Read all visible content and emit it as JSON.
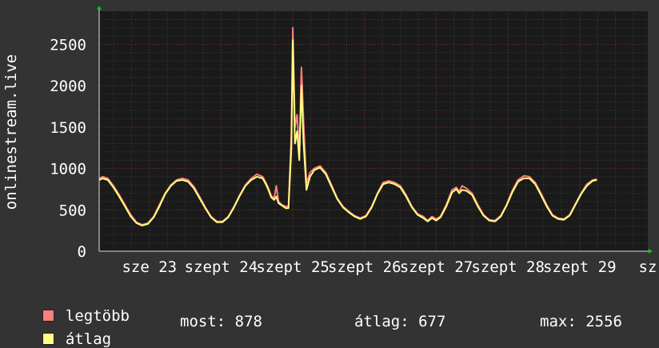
{
  "chart_data": {
    "type": "line",
    "ylabel": "onlinestream.live",
    "ylim": [
      0,
      2900
    ],
    "yticks": [
      0,
      500,
      1000,
      1500,
      2000,
      2500
    ],
    "xlim": [
      22.3,
      29.95
    ],
    "xtick_labels": [
      {
        "x": 23,
        "label": "sze 23"
      },
      {
        "x": 24,
        "label": "szept 24"
      },
      {
        "x": 25,
        "label": "szept 25"
      },
      {
        "x": 26,
        "label": "szept 26"
      },
      {
        "x": 27,
        "label": "szept 27"
      },
      {
        "x": 28,
        "label": "szept 28"
      },
      {
        "x": 29,
        "label": "szept 29"
      },
      {
        "x": 29.95,
        "label": "sz"
      }
    ],
    "grid": true,
    "series": [
      {
        "name": "legtöbb",
        "color": "#ff7f7f",
        "points": [
          [
            22.3,
            880
          ],
          [
            22.35,
            900
          ],
          [
            22.42,
            880
          ],
          [
            22.5,
            790
          ],
          [
            22.58,
            680
          ],
          [
            22.66,
            560
          ],
          [
            22.74,
            440
          ],
          [
            22.82,
            350
          ],
          [
            22.9,
            320
          ],
          [
            22.98,
            340
          ],
          [
            23.06,
            420
          ],
          [
            23.14,
            560
          ],
          [
            23.22,
            700
          ],
          [
            23.3,
            800
          ],
          [
            23.38,
            860
          ],
          [
            23.46,
            880
          ],
          [
            23.54,
            860
          ],
          [
            23.62,
            780
          ],
          [
            23.7,
            660
          ],
          [
            23.78,
            530
          ],
          [
            23.86,
            420
          ],
          [
            23.94,
            360
          ],
          [
            24.02,
            360
          ],
          [
            24.1,
            420
          ],
          [
            24.18,
            540
          ],
          [
            24.26,
            680
          ],
          [
            24.34,
            800
          ],
          [
            24.42,
            880
          ],
          [
            24.5,
            930
          ],
          [
            24.58,
            900
          ],
          [
            24.63,
            820
          ],
          [
            24.66,
            760
          ],
          [
            24.7,
            670
          ],
          [
            24.74,
            640
          ],
          [
            24.77,
            790
          ],
          [
            24.8,
            600
          ],
          [
            24.85,
            560
          ],
          [
            24.9,
            540
          ],
          [
            24.94,
            540
          ],
          [
            24.98,
            1400
          ],
          [
            25.0,
            2700
          ],
          [
            25.03,
            1500
          ],
          [
            25.06,
            1650
          ],
          [
            25.09,
            1150
          ],
          [
            25.12,
            2220
          ],
          [
            25.15,
            1550
          ],
          [
            25.19,
            820
          ],
          [
            25.24,
            950
          ],
          [
            25.3,
            1000
          ],
          [
            25.38,
            1030
          ],
          [
            25.46,
            950
          ],
          [
            25.54,
            800
          ],
          [
            25.62,
            640
          ],
          [
            25.7,
            540
          ],
          [
            25.78,
            480
          ],
          [
            25.86,
            430
          ],
          [
            25.94,
            400
          ],
          [
            26.02,
            430
          ],
          [
            26.1,
            540
          ],
          [
            26.18,
            700
          ],
          [
            26.26,
            830
          ],
          [
            26.34,
            850
          ],
          [
            26.42,
            830
          ],
          [
            26.5,
            790
          ],
          [
            26.58,
            680
          ],
          [
            26.66,
            540
          ],
          [
            26.74,
            450
          ],
          [
            26.82,
            420
          ],
          [
            26.88,
            370
          ],
          [
            26.94,
            420
          ],
          [
            27.0,
            390
          ],
          [
            27.06,
            420
          ],
          [
            27.14,
            560
          ],
          [
            27.22,
            740
          ],
          [
            27.28,
            770
          ],
          [
            27.32,
            720
          ],
          [
            27.36,
            790
          ],
          [
            27.42,
            760
          ],
          [
            27.5,
            700
          ],
          [
            27.58,
            560
          ],
          [
            27.66,
            440
          ],
          [
            27.74,
            380
          ],
          [
            27.82,
            370
          ],
          [
            27.9,
            430
          ],
          [
            27.98,
            560
          ],
          [
            28.06,
            730
          ],
          [
            28.14,
            860
          ],
          [
            28.22,
            910
          ],
          [
            28.3,
            900
          ],
          [
            28.38,
            830
          ],
          [
            28.46,
            700
          ],
          [
            28.54,
            560
          ],
          [
            28.62,
            440
          ],
          [
            28.7,
            400
          ],
          [
            28.78,
            390
          ],
          [
            28.86,
            440
          ],
          [
            28.94,
            570
          ],
          [
            29.02,
            700
          ],
          [
            29.1,
            810
          ],
          [
            29.18,
            860
          ],
          [
            29.24,
            870
          ]
        ]
      },
      {
        "name": "átlag",
        "color": "#ffff7f",
        "points": [
          [
            22.3,
            860
          ],
          [
            22.35,
            880
          ],
          [
            22.42,
            860
          ],
          [
            22.5,
            770
          ],
          [
            22.58,
            660
          ],
          [
            22.66,
            540
          ],
          [
            22.74,
            420
          ],
          [
            22.82,
            340
          ],
          [
            22.9,
            310
          ],
          [
            22.98,
            330
          ],
          [
            23.06,
            410
          ],
          [
            23.14,
            540
          ],
          [
            23.22,
            690
          ],
          [
            23.3,
            790
          ],
          [
            23.38,
            850
          ],
          [
            23.46,
            860
          ],
          [
            23.54,
            840
          ],
          [
            23.62,
            760
          ],
          [
            23.7,
            640
          ],
          [
            23.78,
            520
          ],
          [
            23.86,
            410
          ],
          [
            23.94,
            350
          ],
          [
            24.02,
            350
          ],
          [
            24.1,
            410
          ],
          [
            24.18,
            530
          ],
          [
            24.26,
            670
          ],
          [
            24.34,
            790
          ],
          [
            24.42,
            860
          ],
          [
            24.5,
            900
          ],
          [
            24.58,
            880
          ],
          [
            24.63,
            800
          ],
          [
            24.66,
            740
          ],
          [
            24.7,
            650
          ],
          [
            24.74,
            620
          ],
          [
            24.77,
            660
          ],
          [
            24.8,
            580
          ],
          [
            24.85,
            550
          ],
          [
            24.9,
            520
          ],
          [
            24.94,
            520
          ],
          [
            24.98,
            1250
          ],
          [
            25.0,
            2550
          ],
          [
            25.03,
            1300
          ],
          [
            25.06,
            1450
          ],
          [
            25.09,
            1100
          ],
          [
            25.12,
            2000
          ],
          [
            25.15,
            1300
          ],
          [
            25.19,
            740
          ],
          [
            25.24,
            900
          ],
          [
            25.3,
            980
          ],
          [
            25.38,
            1010
          ],
          [
            25.46,
            930
          ],
          [
            25.54,
            780
          ],
          [
            25.62,
            630
          ],
          [
            25.7,
            530
          ],
          [
            25.78,
            470
          ],
          [
            25.86,
            420
          ],
          [
            25.94,
            390
          ],
          [
            26.02,
            420
          ],
          [
            26.1,
            530
          ],
          [
            26.18,
            690
          ],
          [
            26.26,
            810
          ],
          [
            26.34,
            830
          ],
          [
            26.42,
            810
          ],
          [
            26.5,
            770
          ],
          [
            26.58,
            660
          ],
          [
            26.66,
            530
          ],
          [
            26.74,
            440
          ],
          [
            26.82,
            400
          ],
          [
            26.88,
            360
          ],
          [
            26.94,
            400
          ],
          [
            27.0,
            370
          ],
          [
            27.06,
            410
          ],
          [
            27.14,
            540
          ],
          [
            27.22,
            710
          ],
          [
            27.28,
            750
          ],
          [
            27.32,
            700
          ],
          [
            27.36,
            740
          ],
          [
            27.42,
            730
          ],
          [
            27.5,
            680
          ],
          [
            27.58,
            540
          ],
          [
            27.66,
            430
          ],
          [
            27.74,
            370
          ],
          [
            27.82,
            360
          ],
          [
            27.9,
            420
          ],
          [
            27.98,
            550
          ],
          [
            28.06,
            710
          ],
          [
            28.14,
            840
          ],
          [
            28.22,
            880
          ],
          [
            28.3,
            880
          ],
          [
            28.38,
            810
          ],
          [
            28.46,
            680
          ],
          [
            28.54,
            540
          ],
          [
            28.62,
            430
          ],
          [
            28.7,
            390
          ],
          [
            28.78,
            380
          ],
          [
            28.86,
            430
          ],
          [
            28.94,
            560
          ],
          [
            29.02,
            690
          ],
          [
            29.1,
            790
          ],
          [
            29.18,
            850
          ],
          [
            29.24,
            860
          ]
        ]
      }
    ]
  },
  "legend": {
    "max_label": "legtöbb",
    "avg_label": "átlag",
    "max_color": "#ff7f7f",
    "avg_color": "#ffff7f",
    "most_text": "most: 878",
    "atlag_text": "átlag: 677",
    "max_text": "max: 2556"
  }
}
